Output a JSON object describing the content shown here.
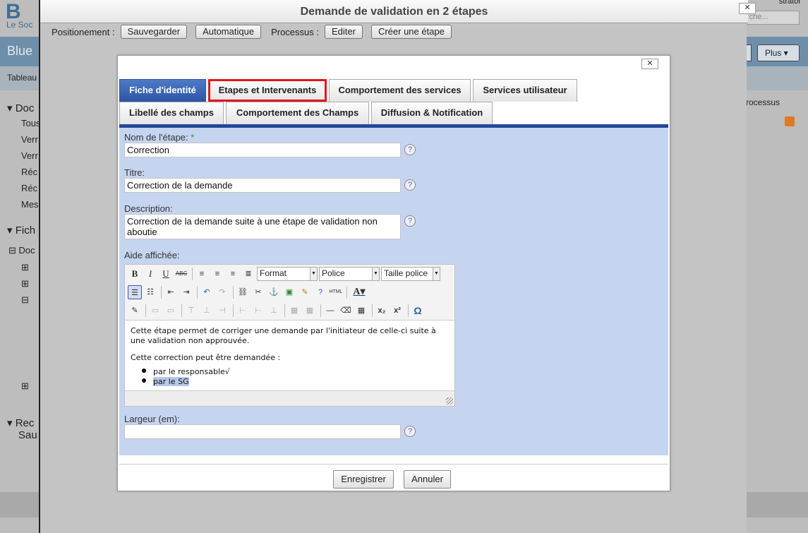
{
  "background": {
    "logo": "B",
    "logo_sub": "Le Soc",
    "app_title": "Blue",
    "tab_label": "Tableau",
    "user": "strator",
    "search_placeholder": "rche...",
    "plus_button": "Plus",
    "processus": "rocessus",
    "sidebar": {
      "sec1": "Doc",
      "items1": [
        "Tous",
        "Verr",
        "Verr",
        "Réc",
        "Réc",
        "Mes"
      ],
      "sec2": "Fich",
      "tree_root": "Doc",
      "sec3a": "Rec",
      "sec3b": "Sau"
    }
  },
  "outer_dialog": {
    "title": "Demande de validation en 2 étapes",
    "close": "✕",
    "positionnement_label": "Positionement :",
    "btn_sauvegarder": "Sauvegarder",
    "btn_automatique": "Automatique",
    "processus_label": "Processus :",
    "btn_editer": "Editer",
    "btn_creer": "Créer une étape"
  },
  "inner_dialog": {
    "close": "✕",
    "tabs": [
      "Fiche d'identité",
      "Etapes et Intervenants",
      "Comportement des services",
      "Services utilisateur",
      "Libellé des champs",
      "Comportement des Champs",
      "Diffusion & Notification"
    ],
    "fields": {
      "nom_label": "Nom de l'étape:",
      "nom_required": "*",
      "nom_value": "Correction",
      "titre_label": "Titre:",
      "titre_value": "Correction de la demande",
      "description_label": "Description:",
      "description_value": "Correction de la demande suite à une étape de validation non aboutie",
      "aide_label": "Aide affichée:",
      "largeur_label": "Largeur (em):",
      "largeur_value": ""
    },
    "editor": {
      "format_select": "Format",
      "police_select": "Police",
      "taille_select": "Taille police",
      "para1": "Cette étape permet de corriger une demande par l'initiateur de celle-ci suite à une validation non approuvée.",
      "para2": "Cette correction peut être demandée :",
      "list": [
        "par le responsable√",
        "par le SG"
      ]
    },
    "btn_enregistrer": "Enregistrer",
    "btn_annuler": "Annuler"
  },
  "colors": {
    "active_tab": "#2b54a8",
    "highlight": "#e0171b",
    "form_bg": "#c5d5f0"
  }
}
